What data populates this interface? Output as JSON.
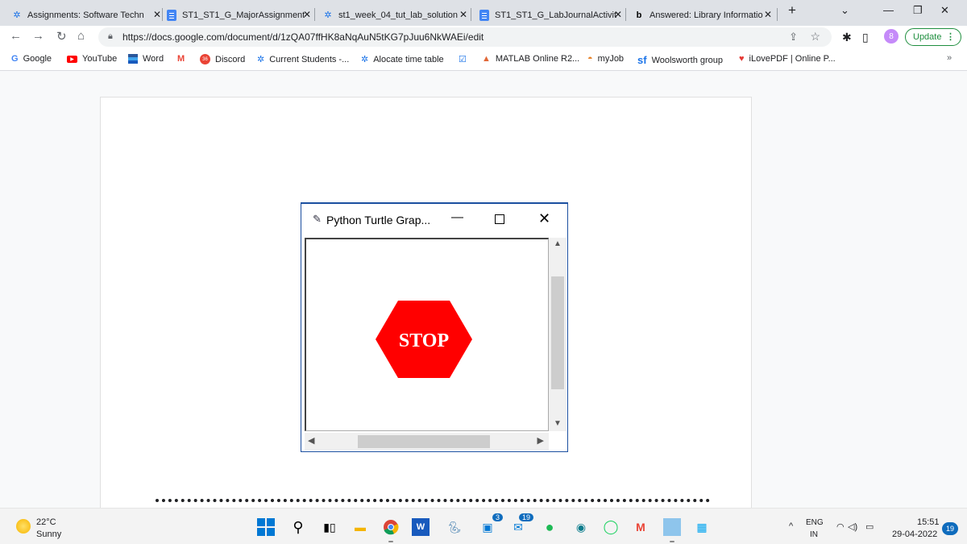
{
  "tabs": [
    {
      "label": "Assignments: Software Techn",
      "icon": "gear-icon",
      "active": false
    },
    {
      "label": "ST1_ST1_G_MajorAssignment",
      "icon": "docs-icon",
      "active": true
    },
    {
      "label": "st1_week_04_tut_lab_solution",
      "icon": "gear-icon",
      "active": false
    },
    {
      "label": "ST1_ST1_G_LabJournalActivit",
      "icon": "docs-icon",
      "active": false
    },
    {
      "label": "Answered: Library Informatio",
      "icon": "bartleby-icon",
      "active": false
    }
  ],
  "tab_close": "✕",
  "new_tab": "+",
  "url": "https://docs.google.com/document/d/1zQA07ffHK8aNqAuN5tKG7pJuu6NkWAEi/edit",
  "update_label": "Update",
  "avatar_letter": "8",
  "bookmarks": [
    {
      "label": "Google",
      "icon": "G"
    },
    {
      "label": "YouTube",
      "icon": "▶"
    },
    {
      "label": "Word",
      "icon": ""
    },
    {
      "label": "",
      "icon": "M"
    },
    {
      "label": "Discord",
      "icon": "36"
    },
    {
      "label": "Current Students -...",
      "icon": "✲"
    },
    {
      "label": "Alocate time table",
      "icon": "✲"
    },
    {
      "label": "",
      "icon": "☑"
    },
    {
      "label": "MATLAB Online R2...",
      "icon": "▲"
    },
    {
      "label": "myJob",
      "icon": "◓"
    },
    {
      "label": "Woolsworth group",
      "icon": "sf"
    },
    {
      "label": "iLovePDF | Online P...",
      "icon": "♥"
    }
  ],
  "bookmarks_more": "»",
  "turtle_window": {
    "title": "Python Turtle Grap...",
    "sign_text": "STOP",
    "sign_color": "#ff0000",
    "scroll_up": "▲",
    "scroll_down": "▼",
    "scroll_left": "◀",
    "scroll_right": "▶"
  },
  "taskbar": {
    "temperature": "22°C",
    "condition": "Sunny",
    "badge_files": "3",
    "badge_chrome": "19",
    "lang_top": "ENG",
    "lang_bottom": "IN",
    "time": "15:51",
    "date": "29-04-2022",
    "notifications": "19"
  }
}
